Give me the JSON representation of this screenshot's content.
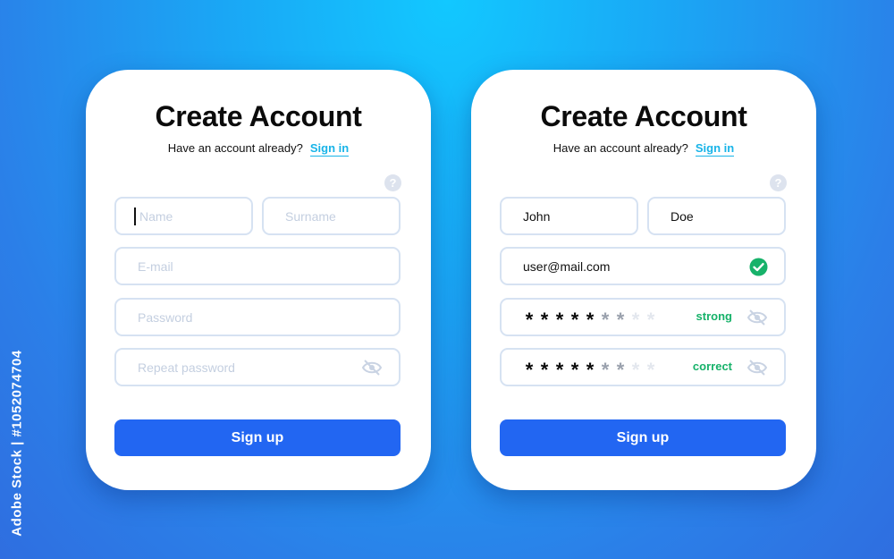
{
  "stock_id": "Adobe Stock | #1052074704",
  "colors": {
    "accent": "#2266f2",
    "link": "#19b4e8",
    "success": "#17b26a",
    "border": "#d6e2f2",
    "placeholder": "#c4cfe0"
  },
  "empty_form": {
    "title": "Create Account",
    "prompt": "Have an account already?",
    "signin_label": "Sign in",
    "help_icon": "?",
    "fields": {
      "name_placeholder": "Name",
      "surname_placeholder": "Surname",
      "email_placeholder": "E-mail",
      "password_placeholder": "Password",
      "repeat_password_placeholder": "Repeat password"
    },
    "repeat_password_icon": "eye-slash-icon",
    "signup_label": "Sign up"
  },
  "filled_form": {
    "title": "Create Account",
    "prompt": "Have an account already?",
    "signin_label": "Sign in",
    "help_icon": "?",
    "fields": {
      "name_value": "John",
      "surname_value": "Doe",
      "email_value": "user@mail.com"
    },
    "email_status_icon": "check-circle-icon",
    "password_strength": "strong",
    "repeat_password_status": "correct",
    "password_icon": "eye-slash-icon",
    "signup_label": "Sign up"
  }
}
